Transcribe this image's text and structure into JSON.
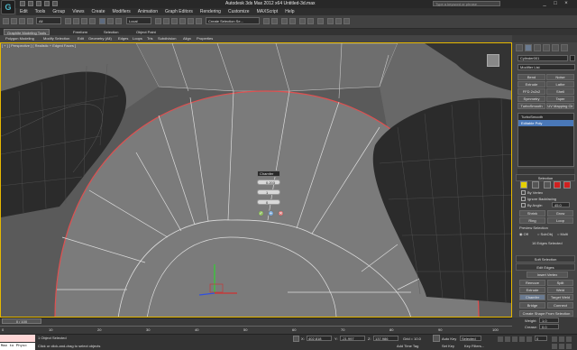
{
  "title_bar": {
    "app_title": "Autodesk 3ds Max 2012 x64    Untitled-3d.max",
    "search_placeholder": "Type a keyword or phrase",
    "logo_glyph": "G"
  },
  "menu": [
    "Edit",
    "Tools",
    "Group",
    "Views",
    "Create",
    "Modifiers",
    "Animation",
    "Graph Editors",
    "Rendering",
    "Customize",
    "MAXScript",
    "Help"
  ],
  "toolbar": {
    "selection_filter": "All",
    "reference_coord": "Local",
    "named_selection": "Create Selection Se..."
  },
  "ribbon": {
    "tabs": [
      "Graphite Modeling Tools",
      "Freeform",
      "Selection",
      "Object Paint"
    ],
    "subtabs": [
      "Polygon Modeling",
      "Modify Selection",
      "Edit",
      "Geometry (All)",
      "Edges",
      "Loops",
      "Tris",
      "Subdivision",
      "Align",
      "Properties"
    ]
  },
  "viewport": {
    "label": "[ + ] [ Perspective ] [ Realistic + Edged Faces ]",
    "border_color": "#e6b800",
    "selected_edge_color": "#e05050"
  },
  "chamfer_caddy": {
    "title": "Chamfer",
    "amount": "0.203",
    "segments": "1",
    "open_value": "0",
    "ok_glyph": "✓",
    "apply_glyph": "+",
    "cancel_glyph": "✕"
  },
  "command_panel": {
    "object_name": "Cylinder001",
    "modifier_list": "Modifier List",
    "modifier_buttons": [
      "Bend",
      "Noise",
      "Extrude",
      "Lathe",
      "FFD 2x2x2",
      "Shell",
      "Symmetry",
      "Taper",
      "TurboSmooth",
      "UV Mapping Clr"
    ],
    "stack": [
      "TurboSmooth",
      "Editable Poly"
    ],
    "selection": {
      "header": "Selection",
      "by_vertex": "By Vertex",
      "ignore_backfacing": "Ignore Backfacing",
      "by_angle": "By Angle:",
      "angle_value": "45.0",
      "shrink": "Shrink",
      "grow": "Grow",
      "ring": "Ring",
      "loop": "Loop",
      "preview_label": "Preview Selection",
      "preview_options": [
        "Off",
        "SubObj",
        "Multi"
      ],
      "status": "16 Edges Selected"
    },
    "soft_selection": "Soft Selection",
    "edit_edges": {
      "header": "Edit Edges",
      "insert_vertex": "Insert Vertex",
      "remove": "Remove",
      "split": "Split",
      "extrude": "Extrude",
      "weld": "Weld",
      "chamfer": "Chamfer",
      "target_weld": "Target Weld",
      "bridge": "Bridge",
      "connect": "Connect",
      "create_shape": "Create Shape From Selection",
      "weight_label": "Weight:",
      "weight_value": "1.0",
      "crease_label": "Crease:",
      "crease_value": "0.0"
    }
  },
  "timeline": {
    "frame_counter": "0 / 100",
    "ticks": [
      "0",
      "10",
      "20",
      "30",
      "40",
      "50",
      "60",
      "70",
      "80",
      "90",
      "100"
    ]
  },
  "status": {
    "maxscript": "Max to Physc",
    "selected": "1 Object Selected",
    "prompt": "Click or click-and-drag to select objects",
    "x_label": "X:",
    "x_value": "402.818",
    "y_label": "Y:",
    "y_value": "-21.997",
    "z_label": "Z:",
    "z_value": "137.986",
    "grid": "Grid = 10.0",
    "add_time_tag": "Add Time Tag",
    "auto_key": "Auto Key",
    "set_key": "Set Key",
    "selected_dropdown": "Selected",
    "key_filters": "Key Filters...",
    "frame_value": "0"
  }
}
